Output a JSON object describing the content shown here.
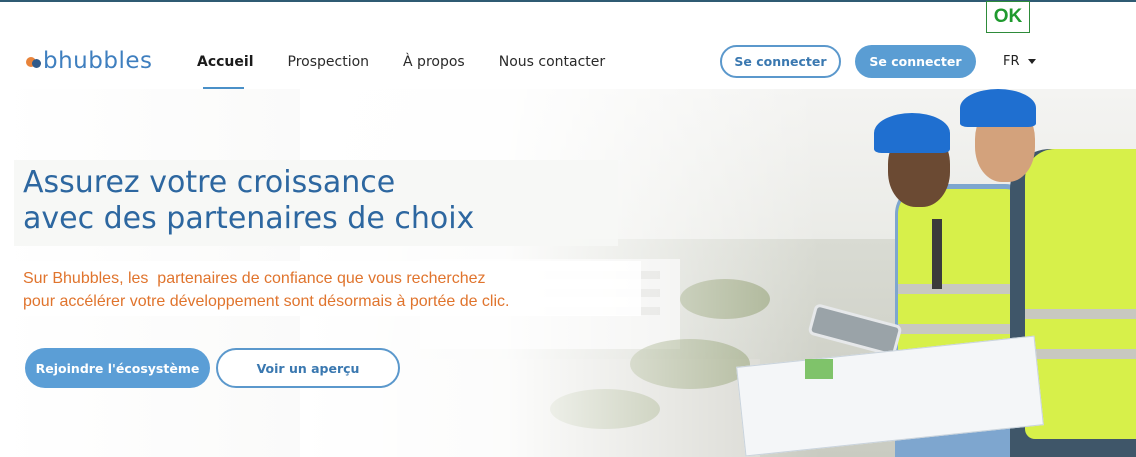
{
  "status_badge": "OK",
  "logo": {
    "text": "bhubbles"
  },
  "nav": {
    "items": [
      {
        "label": "Accueil",
        "active": true
      },
      {
        "label": "Prospection",
        "active": false
      },
      {
        "label": "À propos",
        "active": false
      },
      {
        "label": "Nous contacter",
        "active": false
      }
    ]
  },
  "header": {
    "login_outline_label": "Se connecter",
    "login_filled_label": "Se connecter",
    "language": "FR"
  },
  "hero": {
    "title_line1": "Assurez votre croissance",
    "title_line2": "avec des partenaires de choix",
    "subtitle_line1": "Sur Bhubbles, les  partenaires de confiance que vous recherchez",
    "subtitle_line2": "pour accélérer votre développement sont désormais à portée de clic.",
    "cta_primary": "Rejoindre l'écosystème",
    "cta_secondary": "Voir un aperçu",
    "image_alt": "construction-workers-photo"
  },
  "colors": {
    "brand_blue": "#5a9dd3",
    "title_blue": "#2d67a0",
    "accent_orange": "#e0742d",
    "ok_green": "#1f9a2e"
  }
}
